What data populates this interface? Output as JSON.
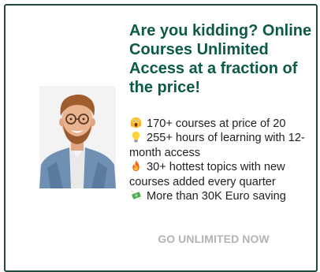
{
  "headline": "Are you kidding? Online Courses Unlimited Access at a fraction of the price!",
  "features": [
    {
      "icon": "shocked-face-icon",
      "text": "170+ courses at price of 20"
    },
    {
      "icon": "lightbulb-icon",
      "text": "255+ hours of learning with 12-month access"
    },
    {
      "icon": "fire-icon",
      "text": "30+ hottest topics with new courses added every quarter"
    },
    {
      "icon": "money-with-wings-icon",
      "text": "More than 30K Euro saving"
    }
  ],
  "cta": {
    "label": "GO UNLIMITED NOW"
  },
  "colors": {
    "border": "#1e4d3d",
    "headline": "#0c5a45",
    "body_text": "#222222",
    "cta_text": "#b3b3b3"
  }
}
